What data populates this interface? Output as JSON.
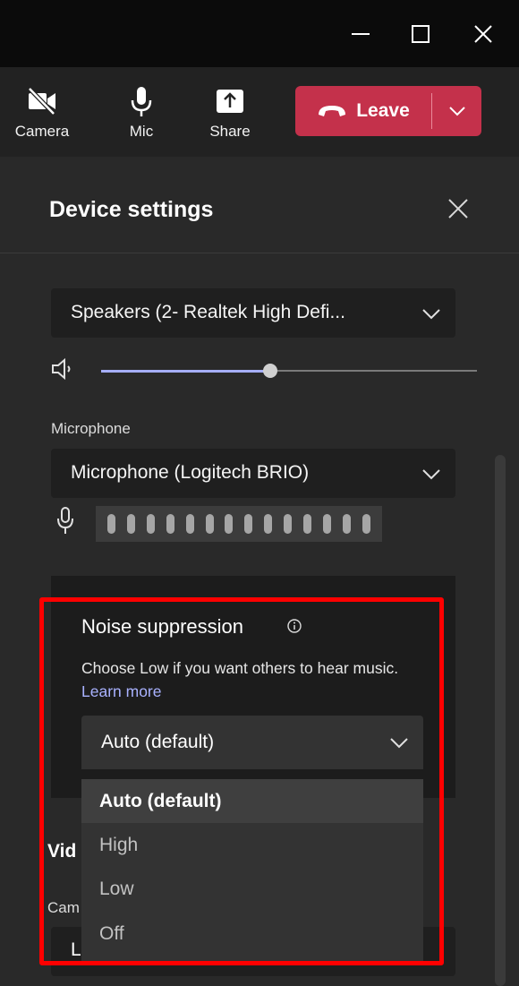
{
  "window_controls": [
    "minimize-icon",
    "maximize-icon",
    "close-icon"
  ],
  "toolbar": {
    "camera_label": "Camera",
    "mic_label": "Mic",
    "share_label": "Share",
    "leave_label": "Leave"
  },
  "panel": {
    "title": "Device settings",
    "speaker": {
      "selected": "Speakers (2- Realtek High Defi...",
      "volume_fraction": 0.45
    },
    "microphone": {
      "label": "Microphone",
      "selected": "Microphone (Logitech BRIO)"
    },
    "noise_suppression": {
      "title": "Noise suppression",
      "desc": "Choose Low if you want others to hear music.",
      "link": "Learn more",
      "selected": "Auto (default)",
      "options": [
        "Auto (default)",
        "High",
        "Low",
        "Off"
      ]
    },
    "video": {
      "section_label": "Vid",
      "camera_label": "Cam",
      "camera_selected": "L"
    }
  },
  "colors": {
    "accent": "#a5aef7",
    "leave": "#c4314b",
    "highlight": "#ff0000"
  }
}
